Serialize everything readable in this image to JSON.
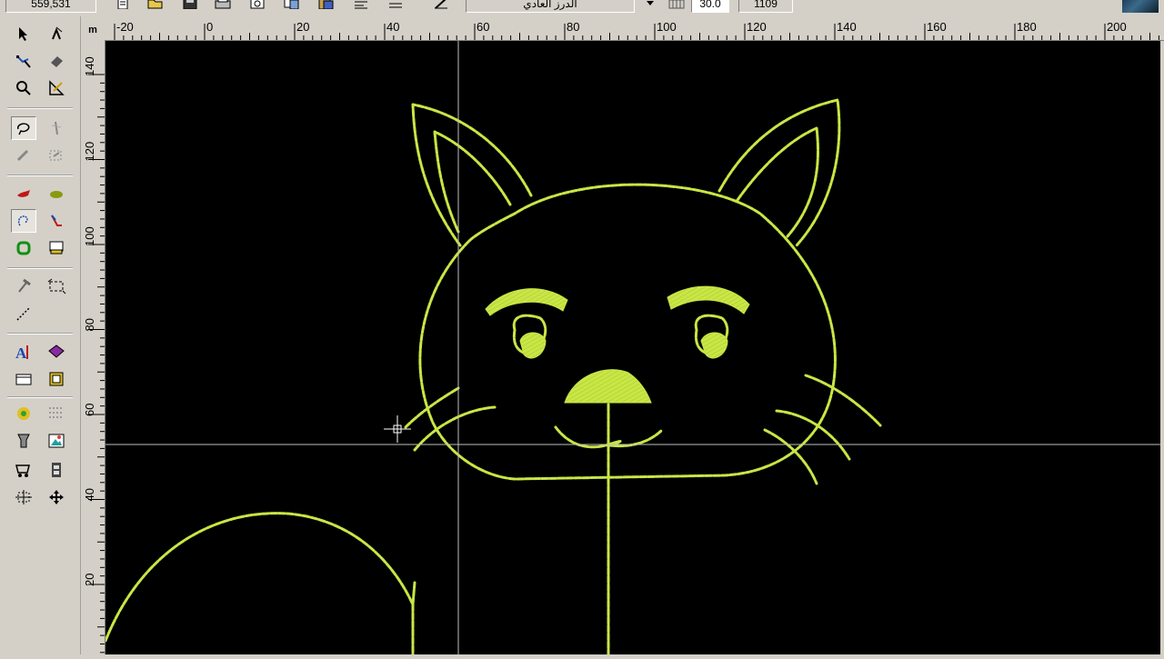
{
  "toolbar": {
    "coords": "559,531",
    "stitch_type": "الدرز العادي",
    "density_value": "30.0",
    "stitch_count": "1109"
  },
  "rulers": {
    "unit": "m",
    "h_ticks": [
      "-20",
      "0",
      "20",
      "40",
      "60",
      "80",
      "100",
      "120",
      "140",
      "160",
      "180",
      "200"
    ],
    "v_ticks": [
      "140",
      "120",
      "100",
      "80",
      "60",
      "40",
      "20"
    ]
  },
  "canvas": {
    "background": "#000000",
    "stitch_color": "#c8e645",
    "guide_color": "#c0c0c0"
  },
  "icons": {
    "toolbar": [
      "new-file-icon",
      "open-folder-icon",
      "save-icon",
      "print-icon",
      "preview-icon",
      "copy-icon",
      "paste-icon",
      "align-icon",
      "settings-icon",
      "edit-icon",
      "dropdown-arrow-icon",
      "density-icon"
    ],
    "tools": [
      "select-arrow-icon",
      "reshape-icon",
      "node-edit-icon",
      "erase-icon",
      "zoom-icon",
      "measure-icon",
      "lasso-icon",
      "needle-icon",
      "knife-icon",
      "transform-icon",
      "fill-satin-icon",
      "fill-tatami-icon",
      "run-stitch-icon",
      "angle-icon",
      "outline-icon",
      "monitor-icon",
      "hammer-icon",
      "rotate-icon",
      "line-icon",
      "lettering-icon",
      "library-icon",
      "folder-icon",
      "frame-icon",
      "color-wheel-icon",
      "grid-icon",
      "appliqué-icon",
      "picture-icon",
      "trolley-icon",
      "film-icon",
      "center-icon",
      "move-icon"
    ]
  }
}
